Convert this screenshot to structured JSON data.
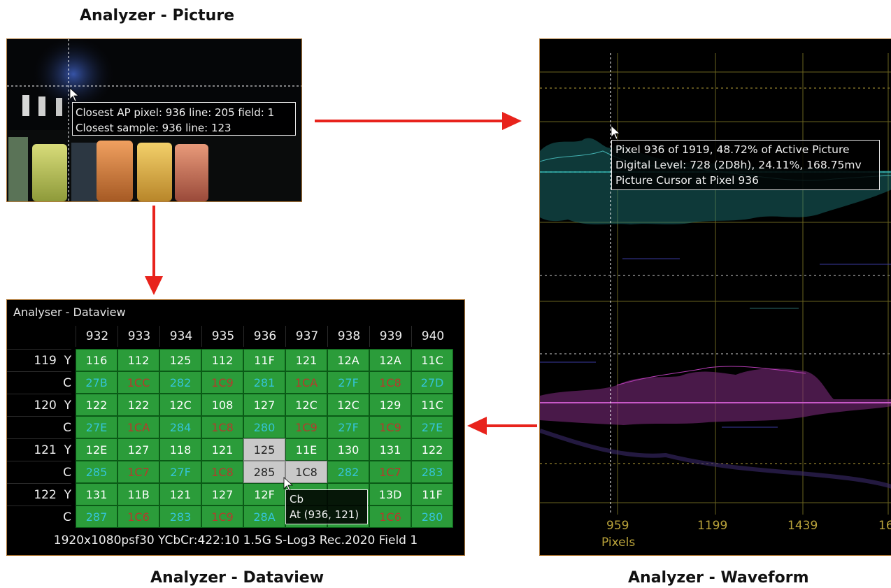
{
  "captions": {
    "picture": "Analyzer - Picture",
    "dataview": "Analyzer - Dataview",
    "waveform": "Analyzer - Waveform"
  },
  "picture": {
    "tooltip_line1": "Closest AP pixel: 936 line: 205 field: 1",
    "tooltip_line2": "Closest sample: 936 line: 123"
  },
  "waveform": {
    "tooltip_line1": "Pixel 936 of 1919, 48.72% of Active Picture",
    "tooltip_line2": "Digital Level: 728 (2D8h), 24.11%, 168.75mv",
    "tooltip_line3": "Picture Cursor at Pixel 936",
    "x_ticks": [
      "959",
      "1199",
      "1439",
      "16"
    ],
    "x_axis_label": "Pixels"
  },
  "dataview": {
    "title": "Analyser - Dataview",
    "columns": [
      "932",
      "933",
      "934",
      "935",
      "936",
      "937",
      "938",
      "939",
      "940"
    ],
    "rows": [
      {
        "label": "119  Y",
        "kind": "y",
        "cells": [
          "116",
          "112",
          "125",
          "112",
          "11F",
          "121",
          "12A",
          "12A",
          "11C"
        ]
      },
      {
        "label": "C",
        "kind": "c",
        "cells": [
          "27B",
          "1CC",
          "282",
          "1C9",
          "281",
          "1CA",
          "27F",
          "1C8",
          "27D"
        ]
      },
      {
        "label": "120  Y",
        "kind": "y",
        "cells": [
          "122",
          "122",
          "12C",
          "108",
          "127",
          "12C",
          "12C",
          "129",
          "11C"
        ]
      },
      {
        "label": "C",
        "kind": "c",
        "cells": [
          "27E",
          "1CA",
          "284",
          "1C8",
          "280",
          "1C9",
          "27F",
          "1C9",
          "27E"
        ]
      },
      {
        "label": "121  Y",
        "kind": "y",
        "cells": [
          "12E",
          "127",
          "118",
          "121",
          "125",
          "11E",
          "130",
          "131",
          "122"
        ]
      },
      {
        "label": "C",
        "kind": "c",
        "cells": [
          "285",
          "1C7",
          "27F",
          "1C8",
          "285",
          "1C8",
          "282",
          "1C7",
          "283"
        ]
      },
      {
        "label": "122  Y",
        "kind": "y",
        "cells": [
          "131",
          "11B",
          "121",
          "127",
          "12F",
          "",
          "",
          "13D",
          "11F"
        ]
      },
      {
        "label": "C",
        "kind": "c",
        "cells": [
          "287",
          "1C6",
          "283",
          "1C9",
          "28A",
          "",
          "",
          "1C6",
          "280"
        ]
      }
    ],
    "selected_cells": [
      [
        4,
        4
      ],
      [
        5,
        4
      ],
      [
        5,
        5
      ]
    ],
    "tooltip_line1": "Cb",
    "tooltip_line2": "At (936, 121)",
    "footer": "1920x1080psf30 YCbCr:422:10 1.5G S-Log3 Rec.2020 Field 1"
  },
  "colors": {
    "arrow": "#e8231c",
    "cell_green": "#2b9c3a",
    "chroma_blue": "#35c4d8",
    "chroma_red": "#b63a2c",
    "waveform_luma": "#2fb0b0",
    "waveform_chroma": "#b43cb4",
    "graticule": "#b9a23a"
  }
}
